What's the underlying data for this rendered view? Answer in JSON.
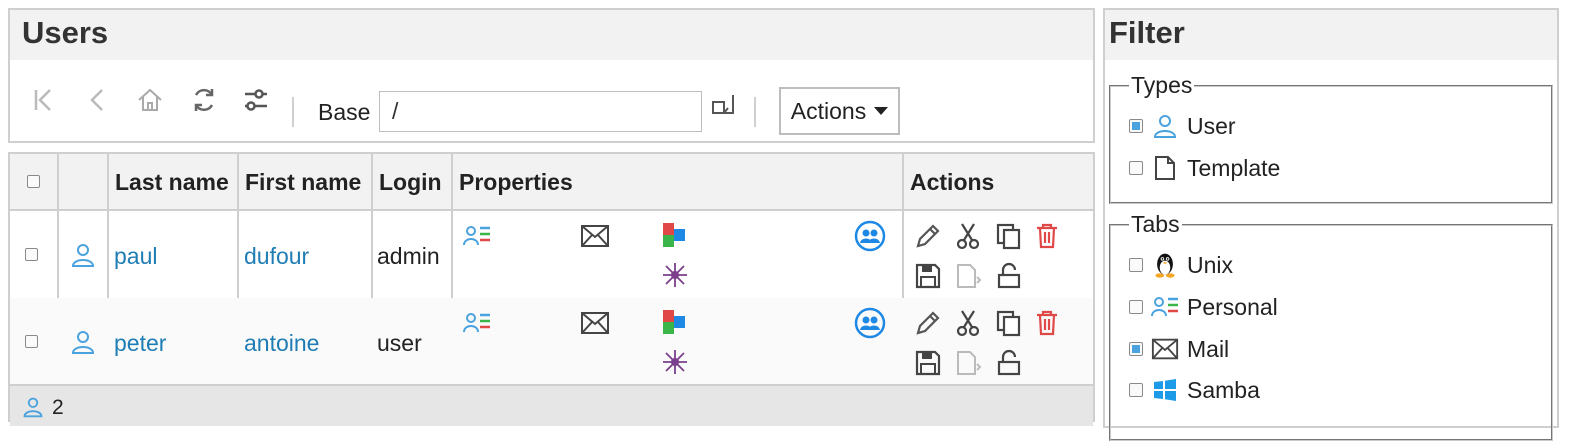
{
  "users_panel": {
    "title": "Users",
    "toolbar": {
      "base_label": "Base",
      "base_value": "/",
      "actions_label": "Actions"
    }
  },
  "table": {
    "columns": [
      "Last name",
      "First name",
      "Login",
      "Properties",
      "Actions"
    ],
    "rows": [
      {
        "last_name": "paul",
        "first_name": "dufour",
        "login": "admin"
      },
      {
        "last_name": "peter",
        "first_name": "antoine",
        "login": "user"
      }
    ],
    "footer_count": "2"
  },
  "filter_panel": {
    "title": "Filter",
    "types": {
      "legend": "Types",
      "items": [
        {
          "label": "User",
          "checked": true,
          "icon": "user-icon"
        },
        {
          "label": "Template",
          "checked": false,
          "icon": "template-icon"
        }
      ]
    },
    "tabs": {
      "legend": "Tabs",
      "items": [
        {
          "label": "Unix",
          "checked": false,
          "icon": "penguin-icon"
        },
        {
          "label": "Personal",
          "checked": false,
          "icon": "personal-icon"
        },
        {
          "label": "Mail",
          "checked": true,
          "icon": "mail-icon"
        },
        {
          "label": "Samba",
          "checked": false,
          "icon": "windows-icon"
        }
      ]
    }
  },
  "colors": {
    "link": "#1f7db5",
    "accent_blue": "#4aa3df",
    "delete_red": "#e04848",
    "header_bg": "#f2f2f2",
    "border": "#cfcfcf"
  }
}
